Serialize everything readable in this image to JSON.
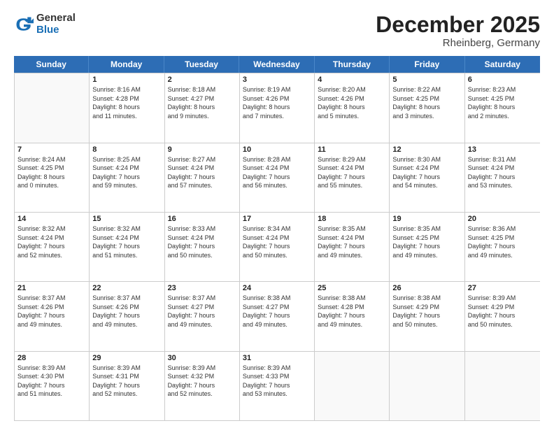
{
  "header": {
    "logo_line1": "General",
    "logo_line2": "Blue",
    "month": "December 2025",
    "location": "Rheinberg, Germany"
  },
  "days": [
    "Sunday",
    "Monday",
    "Tuesday",
    "Wednesday",
    "Thursday",
    "Friday",
    "Saturday"
  ],
  "rows": [
    [
      {
        "day": "",
        "info": ""
      },
      {
        "day": "1",
        "info": "Sunrise: 8:16 AM\nSunset: 4:28 PM\nDaylight: 8 hours\nand 11 minutes."
      },
      {
        "day": "2",
        "info": "Sunrise: 8:18 AM\nSunset: 4:27 PM\nDaylight: 8 hours\nand 9 minutes."
      },
      {
        "day": "3",
        "info": "Sunrise: 8:19 AM\nSunset: 4:26 PM\nDaylight: 8 hours\nand 7 minutes."
      },
      {
        "day": "4",
        "info": "Sunrise: 8:20 AM\nSunset: 4:26 PM\nDaylight: 8 hours\nand 5 minutes."
      },
      {
        "day": "5",
        "info": "Sunrise: 8:22 AM\nSunset: 4:25 PM\nDaylight: 8 hours\nand 3 minutes."
      },
      {
        "day": "6",
        "info": "Sunrise: 8:23 AM\nSunset: 4:25 PM\nDaylight: 8 hours\nand 2 minutes."
      }
    ],
    [
      {
        "day": "7",
        "info": "Sunrise: 8:24 AM\nSunset: 4:25 PM\nDaylight: 8 hours\nand 0 minutes."
      },
      {
        "day": "8",
        "info": "Sunrise: 8:25 AM\nSunset: 4:24 PM\nDaylight: 7 hours\nand 59 minutes."
      },
      {
        "day": "9",
        "info": "Sunrise: 8:27 AM\nSunset: 4:24 PM\nDaylight: 7 hours\nand 57 minutes."
      },
      {
        "day": "10",
        "info": "Sunrise: 8:28 AM\nSunset: 4:24 PM\nDaylight: 7 hours\nand 56 minutes."
      },
      {
        "day": "11",
        "info": "Sunrise: 8:29 AM\nSunset: 4:24 PM\nDaylight: 7 hours\nand 55 minutes."
      },
      {
        "day": "12",
        "info": "Sunrise: 8:30 AM\nSunset: 4:24 PM\nDaylight: 7 hours\nand 54 minutes."
      },
      {
        "day": "13",
        "info": "Sunrise: 8:31 AM\nSunset: 4:24 PM\nDaylight: 7 hours\nand 53 minutes."
      }
    ],
    [
      {
        "day": "14",
        "info": "Sunrise: 8:32 AM\nSunset: 4:24 PM\nDaylight: 7 hours\nand 52 minutes."
      },
      {
        "day": "15",
        "info": "Sunrise: 8:32 AM\nSunset: 4:24 PM\nDaylight: 7 hours\nand 51 minutes."
      },
      {
        "day": "16",
        "info": "Sunrise: 8:33 AM\nSunset: 4:24 PM\nDaylight: 7 hours\nand 50 minutes."
      },
      {
        "day": "17",
        "info": "Sunrise: 8:34 AM\nSunset: 4:24 PM\nDaylight: 7 hours\nand 50 minutes."
      },
      {
        "day": "18",
        "info": "Sunrise: 8:35 AM\nSunset: 4:24 PM\nDaylight: 7 hours\nand 49 minutes."
      },
      {
        "day": "19",
        "info": "Sunrise: 8:35 AM\nSunset: 4:25 PM\nDaylight: 7 hours\nand 49 minutes."
      },
      {
        "day": "20",
        "info": "Sunrise: 8:36 AM\nSunset: 4:25 PM\nDaylight: 7 hours\nand 49 minutes."
      }
    ],
    [
      {
        "day": "21",
        "info": "Sunrise: 8:37 AM\nSunset: 4:26 PM\nDaylight: 7 hours\nand 49 minutes."
      },
      {
        "day": "22",
        "info": "Sunrise: 8:37 AM\nSunset: 4:26 PM\nDaylight: 7 hours\nand 49 minutes."
      },
      {
        "day": "23",
        "info": "Sunrise: 8:37 AM\nSunset: 4:27 PM\nDaylight: 7 hours\nand 49 minutes."
      },
      {
        "day": "24",
        "info": "Sunrise: 8:38 AM\nSunset: 4:27 PM\nDaylight: 7 hours\nand 49 minutes."
      },
      {
        "day": "25",
        "info": "Sunrise: 8:38 AM\nSunset: 4:28 PM\nDaylight: 7 hours\nand 49 minutes."
      },
      {
        "day": "26",
        "info": "Sunrise: 8:38 AM\nSunset: 4:29 PM\nDaylight: 7 hours\nand 50 minutes."
      },
      {
        "day": "27",
        "info": "Sunrise: 8:39 AM\nSunset: 4:29 PM\nDaylight: 7 hours\nand 50 minutes."
      }
    ],
    [
      {
        "day": "28",
        "info": "Sunrise: 8:39 AM\nSunset: 4:30 PM\nDaylight: 7 hours\nand 51 minutes."
      },
      {
        "day": "29",
        "info": "Sunrise: 8:39 AM\nSunset: 4:31 PM\nDaylight: 7 hours\nand 52 minutes."
      },
      {
        "day": "30",
        "info": "Sunrise: 8:39 AM\nSunset: 4:32 PM\nDaylight: 7 hours\nand 52 minutes."
      },
      {
        "day": "31",
        "info": "Sunrise: 8:39 AM\nSunset: 4:33 PM\nDaylight: 7 hours\nand 53 minutes."
      },
      {
        "day": "",
        "info": ""
      },
      {
        "day": "",
        "info": ""
      },
      {
        "day": "",
        "info": ""
      }
    ]
  ]
}
